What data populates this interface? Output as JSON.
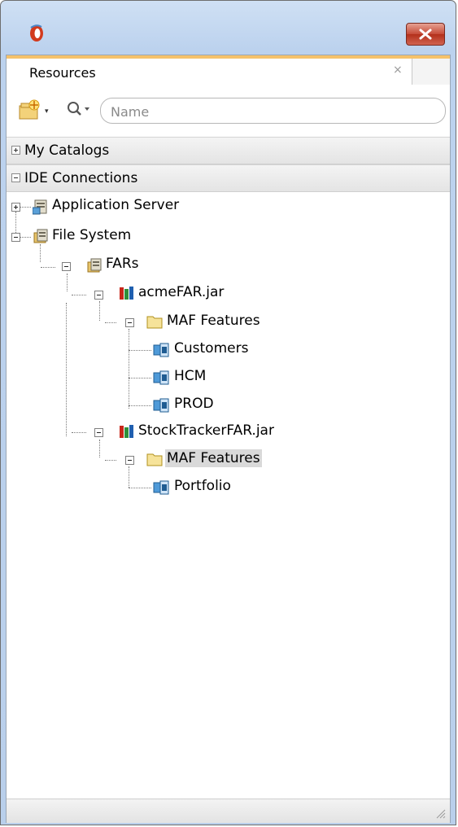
{
  "window": {
    "tab_label": "Resources",
    "tab_close": "×"
  },
  "toolbar": {
    "search_placeholder": "Name",
    "new_dropdown": "▾",
    "search_dropdown": "▾"
  },
  "sections": [
    {
      "label": "My Catalogs",
      "expanded": false
    },
    {
      "label": "IDE Connections",
      "expanded": true
    }
  ],
  "tree": {
    "app_server": "Application Server",
    "file_system": "File System",
    "fars": "FARs",
    "acme_jar": "acmeFAR.jar",
    "acme_features": "MAF Features",
    "customers": "Customers",
    "hcm": "HCM",
    "prod": "PROD",
    "stock_jar": "StockTrackerFAR.jar",
    "stock_features": "MAF Features",
    "portfolio": "Portfolio"
  },
  "colors": {
    "tab_accent": "#f5c26b",
    "selection": "#d9d9d9",
    "close_button": "#c54a37"
  }
}
